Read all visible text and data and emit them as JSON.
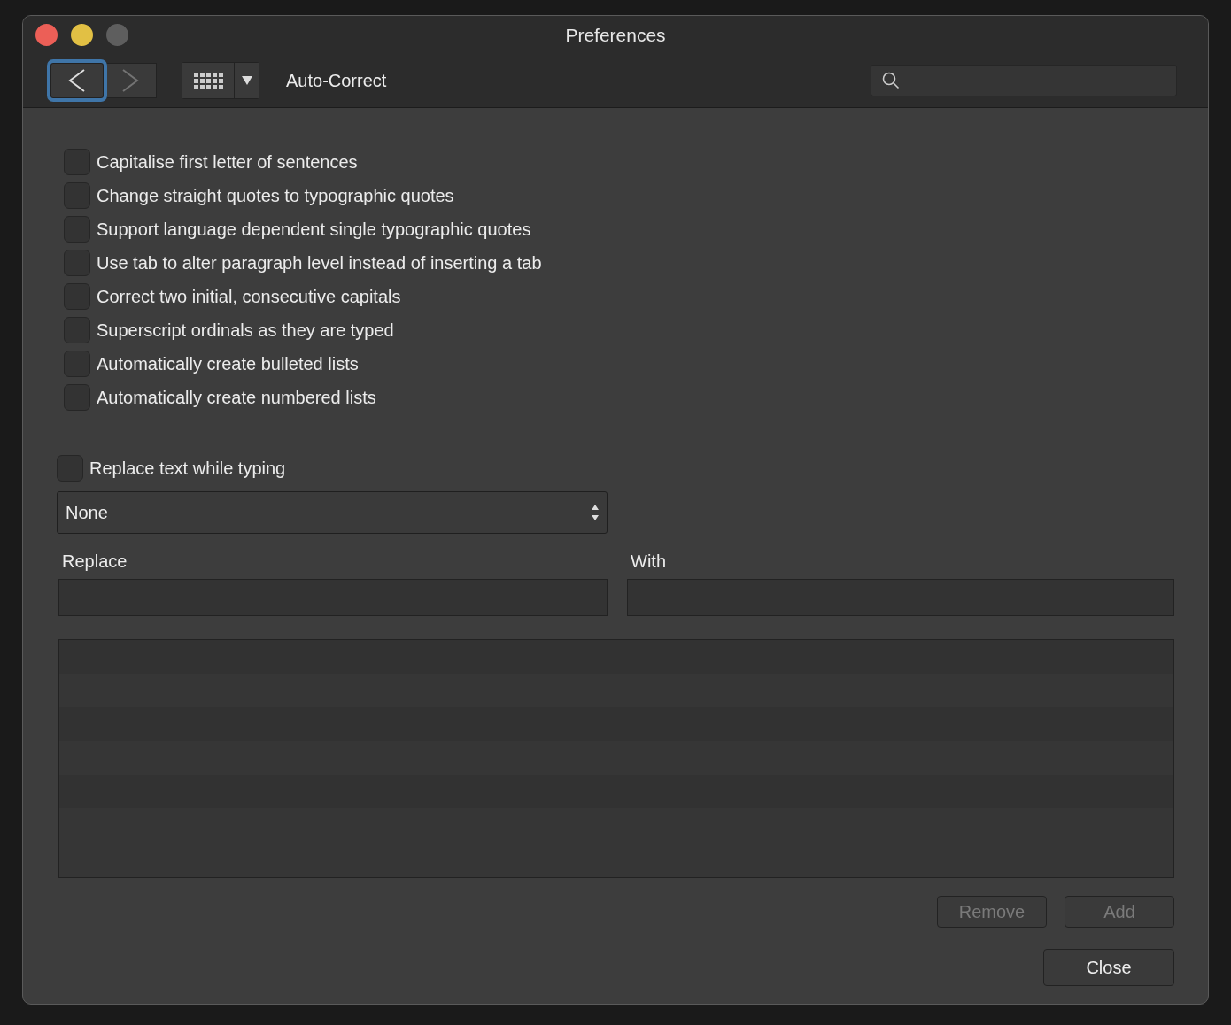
{
  "window": {
    "title": "Preferences"
  },
  "toolbar": {
    "nav_buttons": [
      {
        "kind": "back",
        "focused": true,
        "disabled": false
      },
      {
        "kind": "forward",
        "focused": false,
        "disabled": true
      }
    ],
    "section_title": "Auto-Correct"
  },
  "options": [
    {
      "label": "Capitalise first letter of sentences",
      "checked": false
    },
    {
      "label": "Change straight quotes to typographic quotes",
      "checked": false
    },
    {
      "label": "Support language dependent single typographic quotes",
      "checked": false
    },
    {
      "label": "Use tab to alter paragraph level instead of inserting a tab",
      "checked": false
    },
    {
      "label": "Correct two initial, consecutive capitals",
      "checked": false
    },
    {
      "label": "Superscript ordinals as they are typed",
      "checked": false
    },
    {
      "label": "Automatically create bulleted lists",
      "checked": false
    },
    {
      "label": "Automatically create numbered lists",
      "checked": false
    }
  ],
  "replace_option": {
    "label": "Replace text while typing",
    "checked": false
  },
  "list_select": {
    "value": "None"
  },
  "replace_field": {
    "label": "Replace"
  },
  "with_field": {
    "label": "With"
  },
  "buttons": [
    {
      "label": "Remove",
      "disabled": true
    },
    {
      "label": "Add",
      "disabled": true
    }
  ],
  "close_button": {
    "label": "Close"
  }
}
